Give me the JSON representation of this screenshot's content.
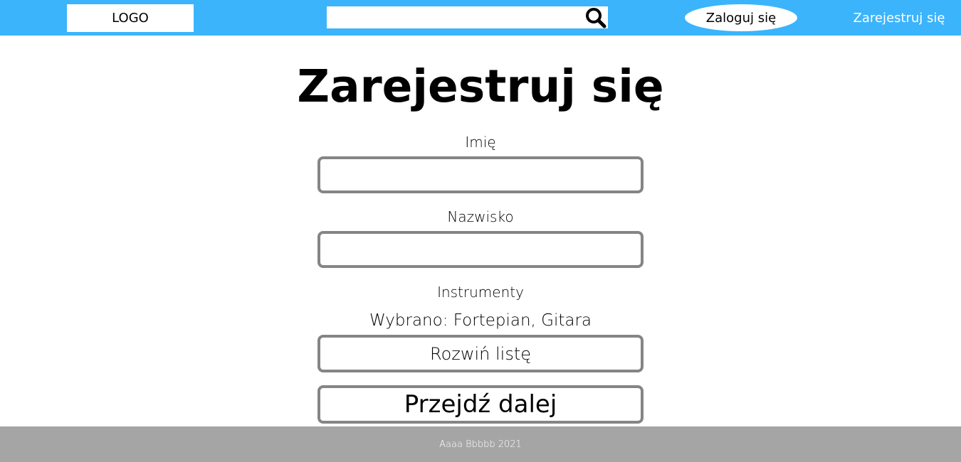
{
  "header": {
    "logo_text": "LOGO",
    "search_placeholder": "",
    "login_label": "Zaloguj się",
    "register_label": "Zarejestruj się",
    "bar_color": "#3bb4fb"
  },
  "main": {
    "title": "Zarejestruj się",
    "first_name_label": "Imię",
    "first_name_value": "",
    "last_name_label": "Nazwisko",
    "last_name_value": "",
    "instruments_label": "Instrumenty",
    "instruments_selected": "Wybrano: Fortepian, Gitara",
    "expand_list_label": "Rozwiń listę",
    "next_button_label": "Przejdź dalej",
    "field_border_color": "#858585"
  },
  "footer": {
    "text": "Aaaa Bbbbb 2021",
    "background_color": "#a5a5a5"
  },
  "icons": {
    "search": "search-icon"
  }
}
